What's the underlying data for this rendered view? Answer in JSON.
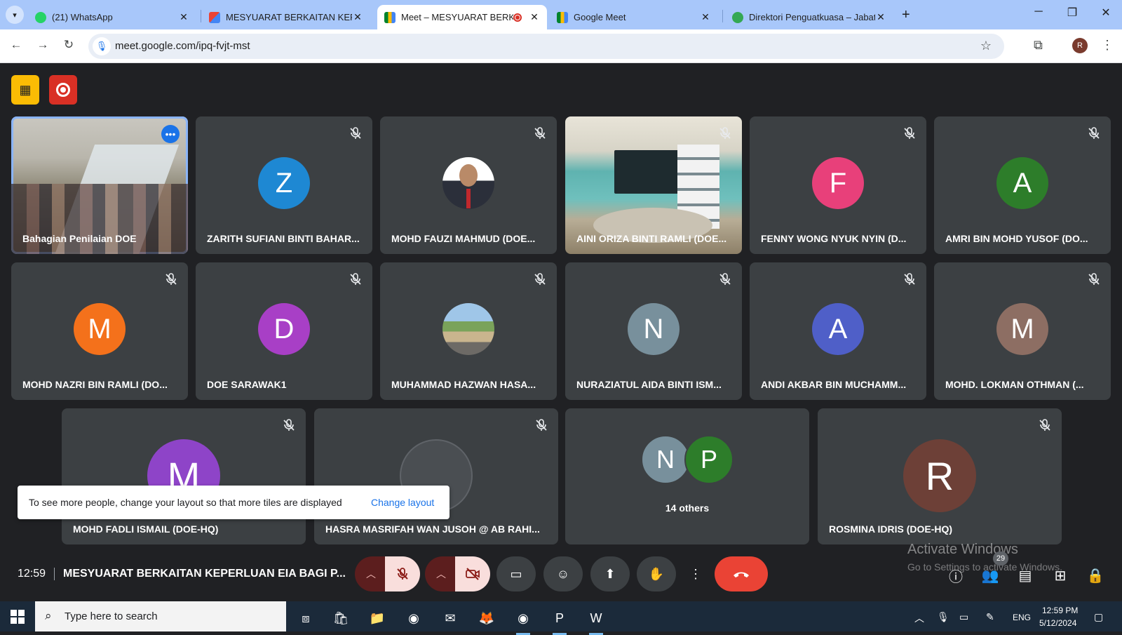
{
  "browser": {
    "tabs": [
      {
        "title": "(21) WhatsApp",
        "favicon": "whatsapp-icon",
        "active": false,
        "badge": "21"
      },
      {
        "title": "MESYUARAT BERKAITAN KEPER",
        "favicon": "gmail-icon",
        "active": false
      },
      {
        "title": "Meet – MESYUARAT BERKAI",
        "favicon": "meet-icon",
        "active": true,
        "recording": true
      },
      {
        "title": "Google Meet",
        "favicon": "meet-icon",
        "active": false
      },
      {
        "title": "Direktori Penguatkuasa – Jabat",
        "favicon": "directory-icon",
        "active": false
      }
    ],
    "url": "meet.google.com/ipq-fvjt-mst",
    "profile_initial": "R"
  },
  "meet": {
    "tiles": [
      {
        "name": "Bahagian Penilaian DOE",
        "kind": "video-room",
        "pinned": true
      },
      {
        "name": "ZARITH SUFIANI BINTI BAHAR...",
        "kind": "initial",
        "initial": "Z",
        "color": "#1e88d3"
      },
      {
        "name": "MOHD FAUZI MAHMUD (DOE...",
        "kind": "photo-man"
      },
      {
        "name": "AINI ORIZA BINTI RAMLI (DOE...",
        "kind": "video-office"
      },
      {
        "name": "FENNY WONG NYUK NYIN (D...",
        "kind": "initial",
        "initial": "F",
        "color": "#e8407a"
      },
      {
        "name": "AMRI BIN MOHD YUSOF (DO...",
        "kind": "initial",
        "initial": "A",
        "color": "#2d7d2a"
      },
      {
        "name": "MOHD NAZRI BIN RAMLI (DO...",
        "kind": "initial",
        "initial": "M",
        "color": "#f4711b"
      },
      {
        "name": "DOE SARAWAK1",
        "kind": "initial",
        "initial": "D",
        "color": "#a83fc6"
      },
      {
        "name": "MUHAMMAD HAZWAN HASA...",
        "kind": "photo-street"
      },
      {
        "name": "NURAZIATUL AIDA BINTI ISM...",
        "kind": "initial",
        "initial": "N",
        "color": "#78909c"
      },
      {
        "name": "ANDI AKBAR BIN MUCHAMM...",
        "kind": "initial",
        "initial": "A",
        "color": "#4f5fc8"
      },
      {
        "name": "MOHD. LOKMAN OTHMAN (...",
        "kind": "initial",
        "initial": "M",
        "color": "#8d6e63"
      },
      {
        "name": "MOHD FADLI ISMAIL (DOE-HQ)",
        "kind": "initial",
        "initial": "M",
        "color": "#8e44c8"
      },
      {
        "name": "HASRA MASRIFAH WAN JUSOH @ AB RAHI...",
        "kind": "ghost"
      },
      {
        "name": "",
        "kind": "others",
        "initials": [
          "N",
          "P"
        ],
        "colors": [
          "#78909c",
          "#2d7d2a"
        ],
        "label": "14 others"
      },
      {
        "name": "ROSMINA IDRIS (DOE-HQ)",
        "kind": "initial",
        "initial": "R",
        "color": "#6d4037"
      }
    ],
    "toast": {
      "text": "To see more people, change your layout so that more tiles are displayed",
      "link": "Change layout"
    },
    "meeting_time": "12:59",
    "meeting_title": "MESYUARAT BERKAITAN KEPERLUAN EIA BAGI P...",
    "participant_count": "29",
    "watermark": {
      "title": "Activate Windows",
      "subtitle": "Go to Settings to activate Windows."
    }
  },
  "taskbar": {
    "search_placeholder": "Type here to search",
    "language": "ENG",
    "time": "12:59 PM",
    "date": "5/12/2024"
  }
}
